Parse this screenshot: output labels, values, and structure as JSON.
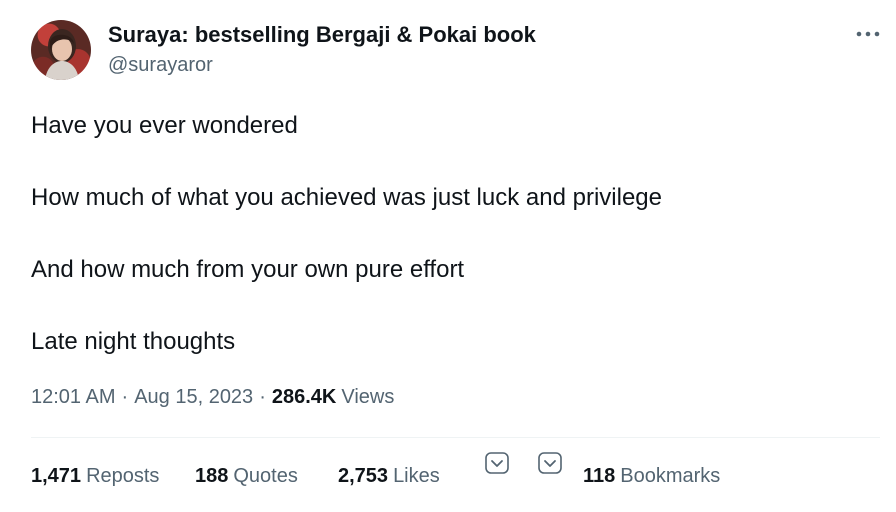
{
  "author": {
    "name": "Suraya: bestselling Bergaji & Pokai book",
    "handle": "@surayaror"
  },
  "tweet": {
    "lines": [
      "Have you ever wondered",
      "How much of what you achieved was just luck and privilege",
      "And how much from your own pure effort",
      "Late night thoughts"
    ]
  },
  "meta": {
    "time": "12:01 AM",
    "separator": "·",
    "date": "Aug 15, 2023",
    "views_count": "286.4K",
    "views_label": "Views"
  },
  "stats": {
    "reposts": {
      "count": "1,471",
      "label": "Reposts"
    },
    "quotes": {
      "count": "188",
      "label": "Quotes"
    },
    "likes": {
      "count": "2,753",
      "label": "Likes"
    },
    "bookmarks": {
      "count": "118",
      "label": "Bookmarks"
    }
  },
  "icons": {
    "more": "more-horizontal-icon",
    "chevron": "chevron-down-icon"
  },
  "colors": {
    "text_primary": "#0f1419",
    "text_secondary": "#536471",
    "divider": "#eff3f4"
  }
}
